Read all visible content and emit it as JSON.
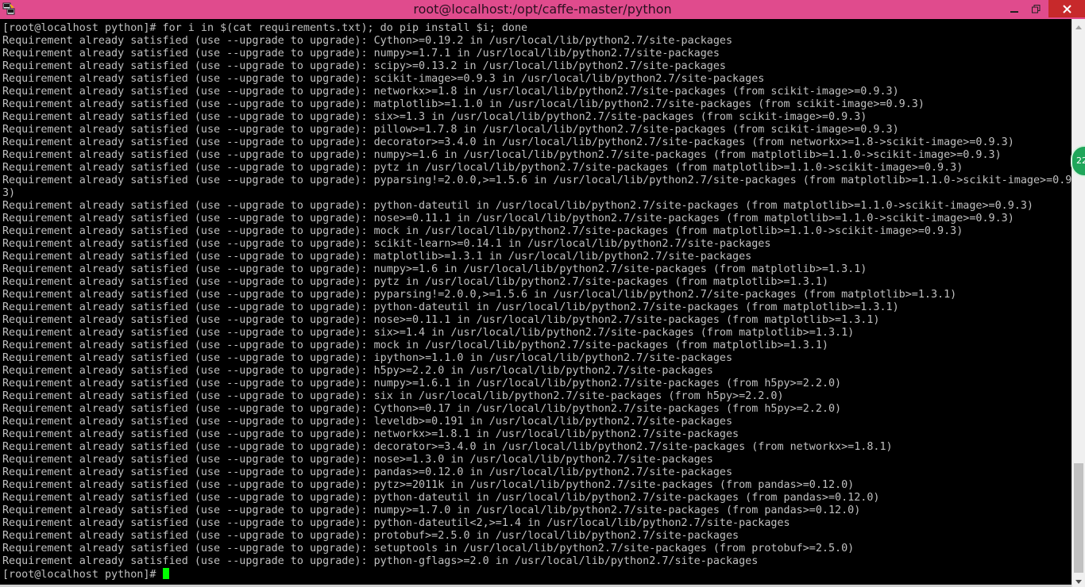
{
  "window": {
    "title": "root@localhost:/opt/caffe-master/python",
    "app_icon": "putty-terminal-icon",
    "controls": {
      "minimize_icon": "minimize-icon",
      "maximize_icon": "restore-icon",
      "close_icon": "close-icon"
    },
    "accent_color": "#e04b8d"
  },
  "terminal": {
    "lines": [
      "[root@localhost python]# for i in $(cat requirements.txt); do pip install $i; done",
      "Requirement already satisfied (use --upgrade to upgrade): Cython>=0.19.2 in /usr/local/lib/python2.7/site-packages",
      "Requirement already satisfied (use --upgrade to upgrade): numpy>=1.7.1 in /usr/local/lib/python2.7/site-packages",
      "Requirement already satisfied (use --upgrade to upgrade): scipy>=0.13.2 in /usr/local/lib/python2.7/site-packages",
      "Requirement already satisfied (use --upgrade to upgrade): scikit-image>=0.9.3 in /usr/local/lib/python2.7/site-packages",
      "Requirement already satisfied (use --upgrade to upgrade): networkx>=1.8 in /usr/local/lib/python2.7/site-packages (from scikit-image>=0.9.3)",
      "Requirement already satisfied (use --upgrade to upgrade): matplotlib>=1.1.0 in /usr/local/lib/python2.7/site-packages (from scikit-image>=0.9.3)",
      "Requirement already satisfied (use --upgrade to upgrade): six>=1.3 in /usr/local/lib/python2.7/site-packages (from scikit-image>=0.9.3)",
      "Requirement already satisfied (use --upgrade to upgrade): pillow>=1.7.8 in /usr/local/lib/python2.7/site-packages (from scikit-image>=0.9.3)",
      "Requirement already satisfied (use --upgrade to upgrade): decorator>=3.4.0 in /usr/local/lib/python2.7/site-packages (from networkx>=1.8->scikit-image>=0.9.3)",
      "Requirement already satisfied (use --upgrade to upgrade): numpy>=1.6 in /usr/local/lib/python2.7/site-packages (from matplotlib>=1.1.0->scikit-image>=0.9.3)",
      "Requirement already satisfied (use --upgrade to upgrade): pytz in /usr/local/lib/python2.7/site-packages (from matplotlib>=1.1.0->scikit-image>=0.9.3)",
      "Requirement already satisfied (use --upgrade to upgrade): pyparsing!=2.0.0,>=1.5.6 in /usr/local/lib/python2.7/site-packages (from matplotlib>=1.1.0->scikit-image>=0.9.",
      "3)",
      "Requirement already satisfied (use --upgrade to upgrade): python-dateutil in /usr/local/lib/python2.7/site-packages (from matplotlib>=1.1.0->scikit-image>=0.9.3)",
      "Requirement already satisfied (use --upgrade to upgrade): nose>=0.11.1 in /usr/local/lib/python2.7/site-packages (from matplotlib>=1.1.0->scikit-image>=0.9.3)",
      "Requirement already satisfied (use --upgrade to upgrade): mock in /usr/local/lib/python2.7/site-packages (from matplotlib>=1.1.0->scikit-image>=0.9.3)",
      "Requirement already satisfied (use --upgrade to upgrade): scikit-learn>=0.14.1 in /usr/local/lib/python2.7/site-packages",
      "Requirement already satisfied (use --upgrade to upgrade): matplotlib>=1.3.1 in /usr/local/lib/python2.7/site-packages",
      "Requirement already satisfied (use --upgrade to upgrade): numpy>=1.6 in /usr/local/lib/python2.7/site-packages (from matplotlib>=1.3.1)",
      "Requirement already satisfied (use --upgrade to upgrade): pytz in /usr/local/lib/python2.7/site-packages (from matplotlib>=1.3.1)",
      "Requirement already satisfied (use --upgrade to upgrade): pyparsing!=2.0.0,>=1.5.6 in /usr/local/lib/python2.7/site-packages (from matplotlib>=1.3.1)",
      "Requirement already satisfied (use --upgrade to upgrade): python-dateutil in /usr/local/lib/python2.7/site-packages (from matplotlib>=1.3.1)",
      "Requirement already satisfied (use --upgrade to upgrade): nose>=0.11.1 in /usr/local/lib/python2.7/site-packages (from matplotlib>=1.3.1)",
      "Requirement already satisfied (use --upgrade to upgrade): six>=1.4 in /usr/local/lib/python2.7/site-packages (from matplotlib>=1.3.1)",
      "Requirement already satisfied (use --upgrade to upgrade): mock in /usr/local/lib/python2.7/site-packages (from matplotlib>=1.3.1)",
      "Requirement already satisfied (use --upgrade to upgrade): ipython>=1.1.0 in /usr/local/lib/python2.7/site-packages",
      "Requirement already satisfied (use --upgrade to upgrade): h5py>=2.2.0 in /usr/local/lib/python2.7/site-packages",
      "Requirement already satisfied (use --upgrade to upgrade): numpy>=1.6.1 in /usr/local/lib/python2.7/site-packages (from h5py>=2.2.0)",
      "Requirement already satisfied (use --upgrade to upgrade): six in /usr/local/lib/python2.7/site-packages (from h5py>=2.2.0)",
      "Requirement already satisfied (use --upgrade to upgrade): Cython>=0.17 in /usr/local/lib/python2.7/site-packages (from h5py>=2.2.0)",
      "Requirement already satisfied (use --upgrade to upgrade): leveldb>=0.191 in /usr/local/lib/python2.7/site-packages",
      "Requirement already satisfied (use --upgrade to upgrade): networkx>=1.8.1 in /usr/local/lib/python2.7/site-packages",
      "Requirement already satisfied (use --upgrade to upgrade): decorator>=3.4.0 in /usr/local/lib/python2.7/site-packages (from networkx>=1.8.1)",
      "Requirement already satisfied (use --upgrade to upgrade): nose>=1.3.0 in /usr/local/lib/python2.7/site-packages",
      "Requirement already satisfied (use --upgrade to upgrade): pandas>=0.12.0 in /usr/local/lib/python2.7/site-packages",
      "Requirement already satisfied (use --upgrade to upgrade): pytz>=2011k in /usr/local/lib/python2.7/site-packages (from pandas>=0.12.0)",
      "Requirement already satisfied (use --upgrade to upgrade): python-dateutil in /usr/local/lib/python2.7/site-packages (from pandas>=0.12.0)",
      "Requirement already satisfied (use --upgrade to upgrade): numpy>=1.7.0 in /usr/local/lib/python2.7/site-packages (from pandas>=0.12.0)",
      "Requirement already satisfied (use --upgrade to upgrade): python-dateutil<2,>=1.4 in /usr/local/lib/python2.7/site-packages",
      "Requirement already satisfied (use --upgrade to upgrade): protobuf>=2.5.0 in /usr/local/lib/python2.7/site-packages",
      "Requirement already satisfied (use --upgrade to upgrade): setuptools in /usr/local/lib/python2.7/site-packages (from protobuf>=2.5.0)",
      "Requirement already satisfied (use --upgrade to upgrade): python-gflags>=2.0 in /usr/local/lib/python2.7/site-packages"
    ],
    "prompt": "[root@localhost python]# ",
    "text_color": "#c0c0c0",
    "cursor_color": "#00ff00"
  },
  "scrollbar": {
    "position_fraction": 0.9
  },
  "overlay_badge": {
    "text": "22"
  }
}
